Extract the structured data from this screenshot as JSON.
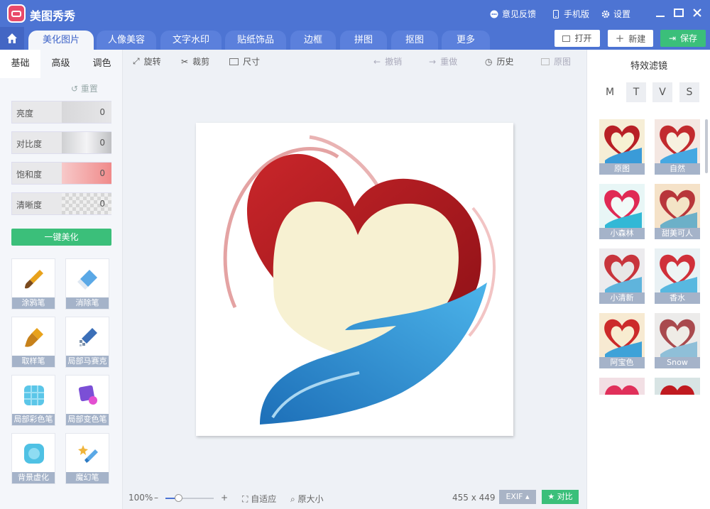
{
  "app": {
    "title": "美图秀秀"
  },
  "titlebar": {
    "feedback": "意见反馈",
    "mobile": "手机版",
    "settings": "设置"
  },
  "nav": {
    "tabs": [
      "美化图片",
      "人像美容",
      "文字水印",
      "贴纸饰品",
      "边框",
      "拼图",
      "抠图",
      "更多"
    ],
    "open": "打开",
    "new": "新建",
    "save": "保存"
  },
  "left": {
    "subtabs": [
      "基础",
      "高级",
      "调色"
    ],
    "reset": "重置",
    "sliders": [
      {
        "label": "亮度",
        "value": "0"
      },
      {
        "label": "对比度",
        "value": "0"
      },
      {
        "label": "饱和度",
        "value": "0"
      },
      {
        "label": "清晰度",
        "value": "0"
      }
    ],
    "onekey": "一键美化",
    "tools": [
      "涂鸦笔",
      "消除笔",
      "取样笔",
      "局部马赛克",
      "局部彩色笔",
      "局部变色笔",
      "背景虚化",
      "魔幻笔"
    ]
  },
  "center": {
    "toolbar": {
      "rotate": "旋转",
      "crop": "裁剪",
      "size": "尺寸",
      "undo": "撤销",
      "redo": "重做",
      "history": "历史",
      "original": "原图"
    },
    "bottom": {
      "zoom": "100%",
      "fit": "自适应",
      "actual": "原大小",
      "dimensions": "455 x 449",
      "exif": "EXIF",
      "compare": "对比"
    }
  },
  "right": {
    "title": "特效滤镜",
    "tabs": [
      "M",
      "T",
      "V",
      "S"
    ],
    "filters": [
      "原图",
      "自然",
      "小森林",
      "甜美可人",
      "小清新",
      "香水",
      "阿宝色",
      "Snow"
    ]
  },
  "colors": {
    "brand": "#4d74d3",
    "accent_green": "#3bbf7a"
  }
}
